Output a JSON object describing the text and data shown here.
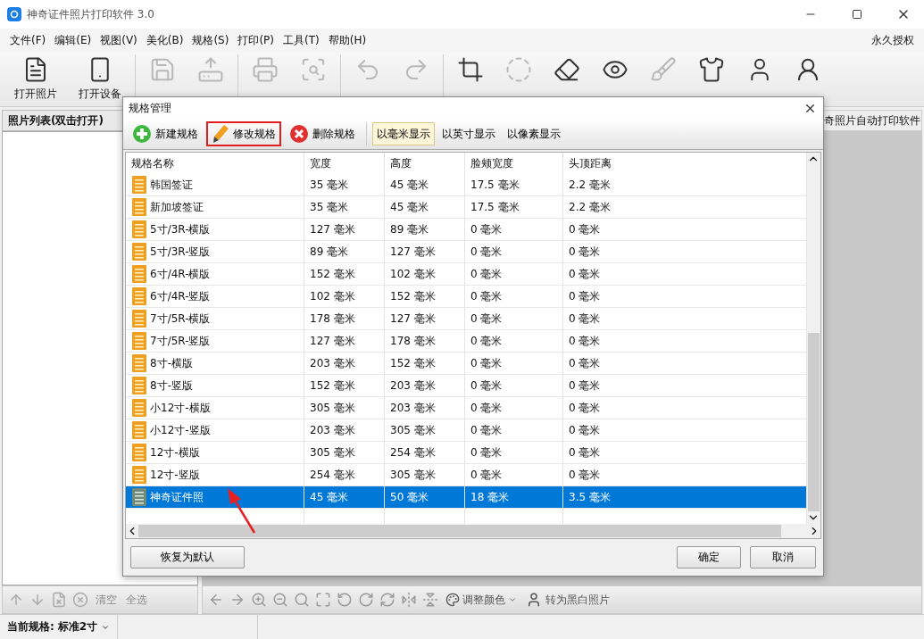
{
  "window": {
    "title": "神奇证件照片打印软件 3.0"
  },
  "menu": {
    "items": [
      "文件(F)",
      "编辑(E)",
      "视图(V)",
      "美化(B)",
      "规格(S)",
      "打印(P)",
      "工具(T)",
      "帮助(H)"
    ],
    "license": "永久授权"
  },
  "toolbar": [
    {
      "label": "打开照片",
      "disabled": false
    },
    {
      "label": "打开设备",
      "disabled": false
    },
    {
      "disabled": true
    },
    {
      "disabled": true
    },
    {
      "disabled": true
    },
    {
      "disabled": true
    },
    {
      "disabled": true
    },
    {
      "disabled": true
    },
    {
      "disabled": false
    },
    {
      "disabled": true
    },
    {
      "disabled": false
    },
    {
      "disabled": false
    },
    {
      "disabled": true
    },
    {
      "disabled": false
    },
    {
      "disabled": false
    },
    {
      "disabled": false
    }
  ],
  "photo_list": {
    "title": "照片列表(双击打开)",
    "buttons": [
      "清空",
      "全选"
    ]
  },
  "canvas": {
    "banner": "奇照片自动打印软件"
  },
  "image_toolbar": {
    "color_button": "调整颜色",
    "grayscale_button": "转为黑白照片"
  },
  "status_bar": {
    "label": "当前规格:",
    "value": "标准2寸"
  },
  "dialog": {
    "title": "规格管理",
    "actions": [
      {
        "label": "新建规格",
        "highlighted": false
      },
      {
        "label": "修改规格",
        "highlighted": true
      },
      {
        "label": "删除规格",
        "highlighted": false
      }
    ],
    "units": [
      {
        "label": "以毫米显示",
        "selected": true
      },
      {
        "label": "以英寸显示",
        "selected": false
      },
      {
        "label": "以像素显示",
        "selected": false
      }
    ],
    "columns": [
      "规格名称",
      "宽度",
      "高度",
      "脸颊宽度",
      "头顶距离"
    ],
    "rows": [
      {
        "kind": "preset",
        "selected": false,
        "cells": [
          "韩国签证",
          "35 毫米",
          "45 毫米",
          "17.5 毫米",
          "2.2 毫米"
        ]
      },
      {
        "kind": "preset",
        "selected": false,
        "cells": [
          "新加坡签证",
          "35 毫米",
          "45 毫米",
          "17.5 毫米",
          "2.2 毫米"
        ]
      },
      {
        "kind": "preset",
        "selected": false,
        "cells": [
          "5寸/3R-横版",
          "127 毫米",
          "89 毫米",
          "0 毫米",
          "0 毫米"
        ]
      },
      {
        "kind": "preset",
        "selected": false,
        "cells": [
          "5寸/3R-竖版",
          "89 毫米",
          "127 毫米",
          "0 毫米",
          "0 毫米"
        ]
      },
      {
        "kind": "preset",
        "selected": false,
        "cells": [
          "6寸/4R-横版",
          "152 毫米",
          "102 毫米",
          "0 毫米",
          "0 毫米"
        ]
      },
      {
        "kind": "preset",
        "selected": false,
        "cells": [
          "6寸/4R-竖版",
          "102 毫米",
          "152 毫米",
          "0 毫米",
          "0 毫米"
        ]
      },
      {
        "kind": "preset",
        "selected": false,
        "cells": [
          "7寸/5R-横版",
          "178 毫米",
          "127 毫米",
          "0 毫米",
          "0 毫米"
        ]
      },
      {
        "kind": "preset",
        "selected": false,
        "cells": [
          "7寸/5R-竖版",
          "127 毫米",
          "178 毫米",
          "0 毫米",
          "0 毫米"
        ]
      },
      {
        "kind": "preset",
        "selected": false,
        "cells": [
          "8寸-横版",
          "203 毫米",
          "152 毫米",
          "0 毫米",
          "0 毫米"
        ]
      },
      {
        "kind": "preset",
        "selected": false,
        "cells": [
          "8寸-竖版",
          "152 毫米",
          "203 毫米",
          "0 毫米",
          "0 毫米"
        ]
      },
      {
        "kind": "preset",
        "selected": false,
        "cells": [
          "小12寸-横版",
          "305 毫米",
          "203 毫米",
          "0 毫米",
          "0 毫米"
        ]
      },
      {
        "kind": "preset",
        "selected": false,
        "cells": [
          "小12寸-竖版",
          "203 毫米",
          "305 毫米",
          "0 毫米",
          "0 毫米"
        ]
      },
      {
        "kind": "preset",
        "selected": false,
        "cells": [
          "12寸-横版",
          "305 毫米",
          "254 毫米",
          "0 毫米",
          "0 毫米"
        ]
      },
      {
        "kind": "preset",
        "selected": false,
        "cells": [
          "12寸-竖版",
          "254 毫米",
          "305 毫米",
          "0 毫米",
          "0 毫米"
        ]
      },
      {
        "kind": "custom",
        "selected": true,
        "cells": [
          "神奇证件照",
          "45 毫米",
          "50 毫米",
          "18 毫米",
          "3.5 毫米"
        ]
      }
    ],
    "buttons": {
      "reset": "恢复为默认",
      "ok": "确定",
      "cancel": "取消"
    }
  }
}
